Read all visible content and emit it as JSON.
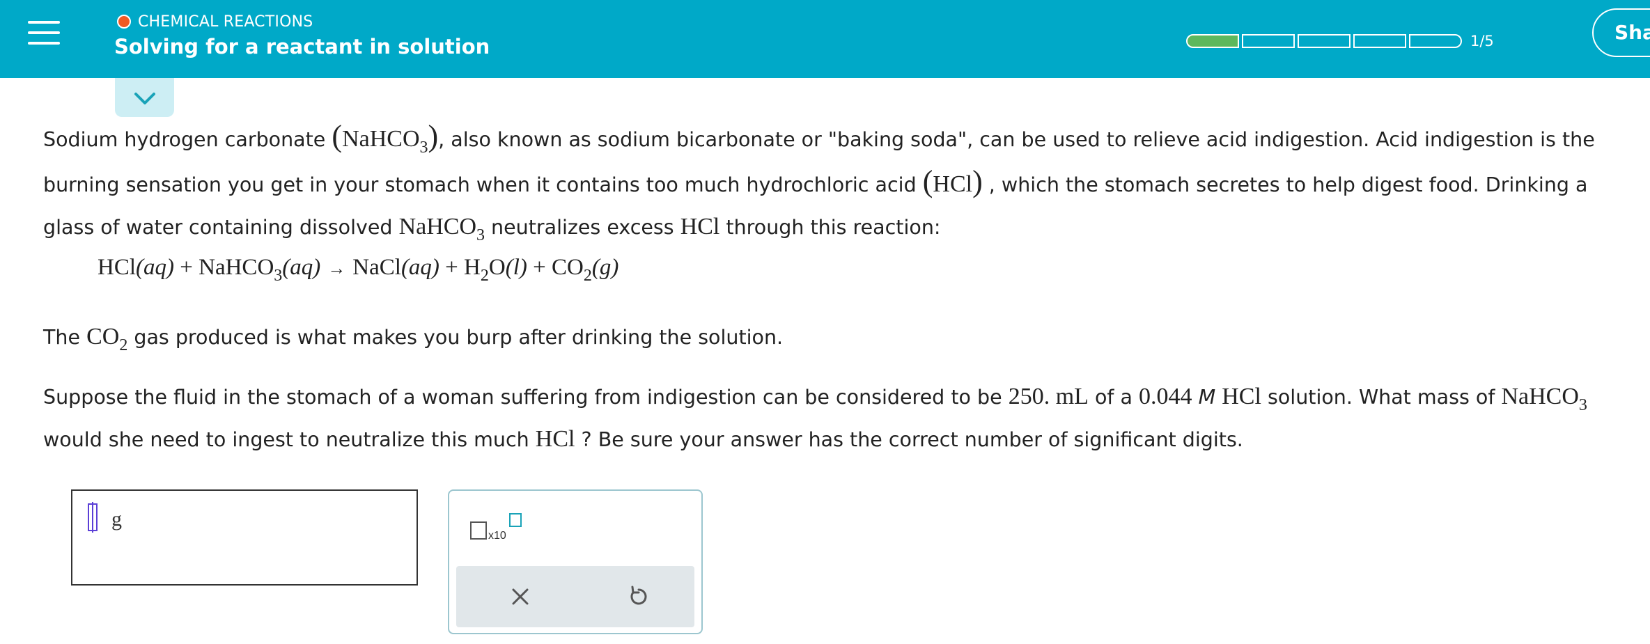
{
  "header": {
    "topic": "CHEMICAL REACTIONS",
    "title": "Solving for a reactant in solution",
    "progress_label": "1/5",
    "progress_fraction": 0.2,
    "share_label": "Sha",
    "accent_color": "#00a9c8",
    "progress_color": "#5db85d",
    "topic_dot_color": "#f15a24"
  },
  "icons": {
    "menu": "hamburger-icon",
    "collapse": "chevron-down-icon",
    "clear": "x-icon",
    "undo": "undo-icon",
    "sci_notation": "x10-icon"
  },
  "problem": {
    "p1_a": "Sodium hydrogen carbonate ",
    "p1_formula": "NaHCO",
    "p1_formula_sub": "3",
    "p1_b": ", also known as sodium bicarbonate or \"baking soda\", can be used to relieve acid indigestion. Acid indigestion is the burning sensation you get in your stomach when it contains too much hydrochloric acid ",
    "p1_hcl": "HCl",
    "p1_c": " , which the stomach secretes to help digest food. Drinking a glass of water containing dissolved ",
    "p1_formula2": "NaHCO",
    "p1_formula2_sub": "3",
    "p1_d": " neutralizes excess ",
    "p1_hcl2": "HCl",
    "p1_e": " through this reaction:",
    "eq": {
      "r1": "HCl",
      "r1_state": "(aq)",
      "plus1": " + ",
      "r2": "NaHCO",
      "r2_sub": "3",
      "r2_state": "(aq)",
      "arrow": "→",
      "p1": "NaCl",
      "p1_state": "(aq)",
      "plus2": " + ",
      "p2a": "H",
      "p2_sub": "2",
      "p2b": "O",
      "p2_state": "(l)",
      "plus3": " + ",
      "p3": "CO",
      "p3_sub": "2",
      "p3_state": "(g)"
    },
    "p2_a": "The ",
    "p2_formula": "CO",
    "p2_formula_sub": "2",
    "p2_b": " gas produced is what makes you burp after drinking the solution.",
    "p3_a": "Suppose the fluid in the stomach of a woman suffering from indigestion can be considered to be ",
    "p3_vol": "250. mL",
    "p3_b": " of a ",
    "p3_conc": "0.044",
    "p3_M": "M",
    "p3_hcl": "HCl",
    "p3_c": " solution. What mass of ",
    "p3_formula": "NaHCO",
    "p3_formula_sub": "3",
    "p3_d": " would she need to ingest to neutralize this much ",
    "p3_hcl2": "HCl",
    "p3_e": " ? Be sure your answer has the correct number of significant digits."
  },
  "answer": {
    "value": "",
    "unit": "g",
    "sci_text": "x10"
  }
}
